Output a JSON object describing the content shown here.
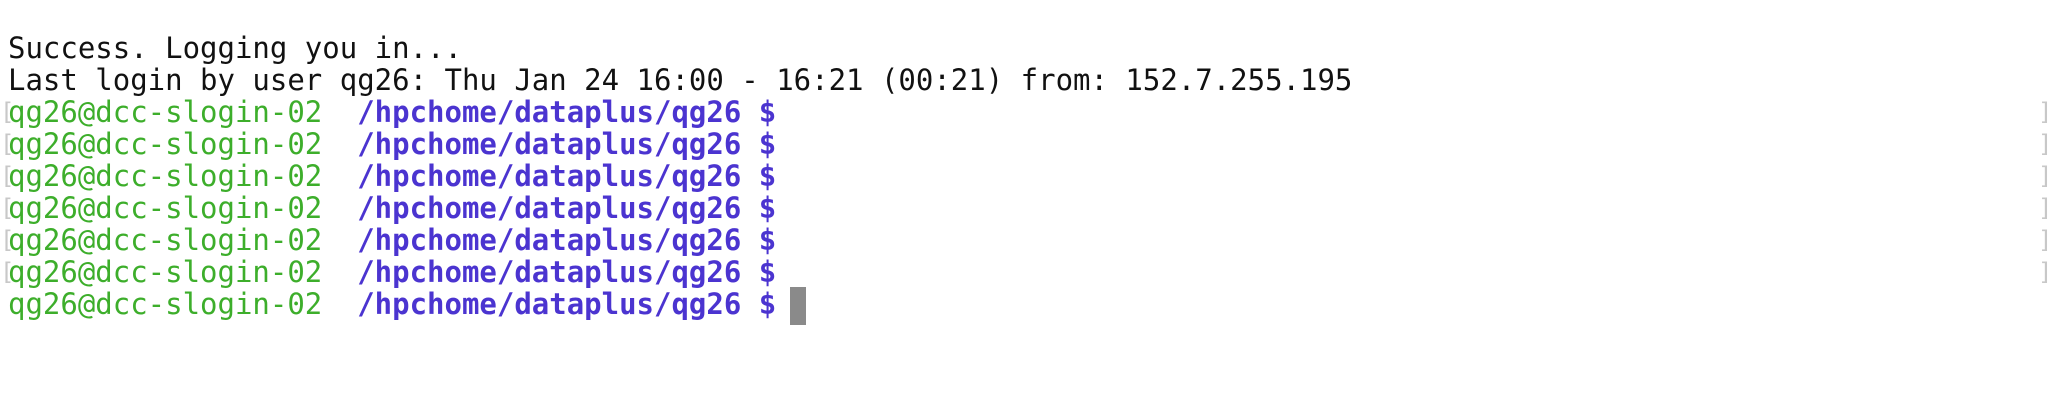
{
  "terminal": {
    "messages": [
      "Success. Logging you in...",
      "Last login by user qg26: Thu Jan 24 16:00 - 16:21 (00:21) from: 152.7.255.195"
    ],
    "prompts": [
      {
        "user_host": "qg26@dcc-slogin-02",
        "path": "/hpchome/dataplus/qg26",
        "symbol": "$"
      },
      {
        "user_host": "qg26@dcc-slogin-02",
        "path": "/hpchome/dataplus/qg26",
        "symbol": "$"
      },
      {
        "user_host": "qg26@dcc-slogin-02",
        "path": "/hpchome/dataplus/qg26",
        "symbol": "$"
      },
      {
        "user_host": "qg26@dcc-slogin-02",
        "path": "/hpchome/dataplus/qg26",
        "symbol": "$"
      },
      {
        "user_host": "qg26@dcc-slogin-02",
        "path": "/hpchome/dataplus/qg26",
        "symbol": "$"
      },
      {
        "user_host": "qg26@dcc-slogin-02",
        "path": "/hpchome/dataplus/qg26",
        "symbol": "$"
      },
      {
        "user_host": "qg26@dcc-slogin-02",
        "path": "/hpchome/dataplus/qg26",
        "symbol": "$"
      }
    ],
    "bracket_left": "[",
    "bracket_right": "]",
    "colors": {
      "user_host": "#3dae2b",
      "path": "#4b34d0",
      "text": "#111111",
      "cursor": "#8a8a8a"
    }
  }
}
